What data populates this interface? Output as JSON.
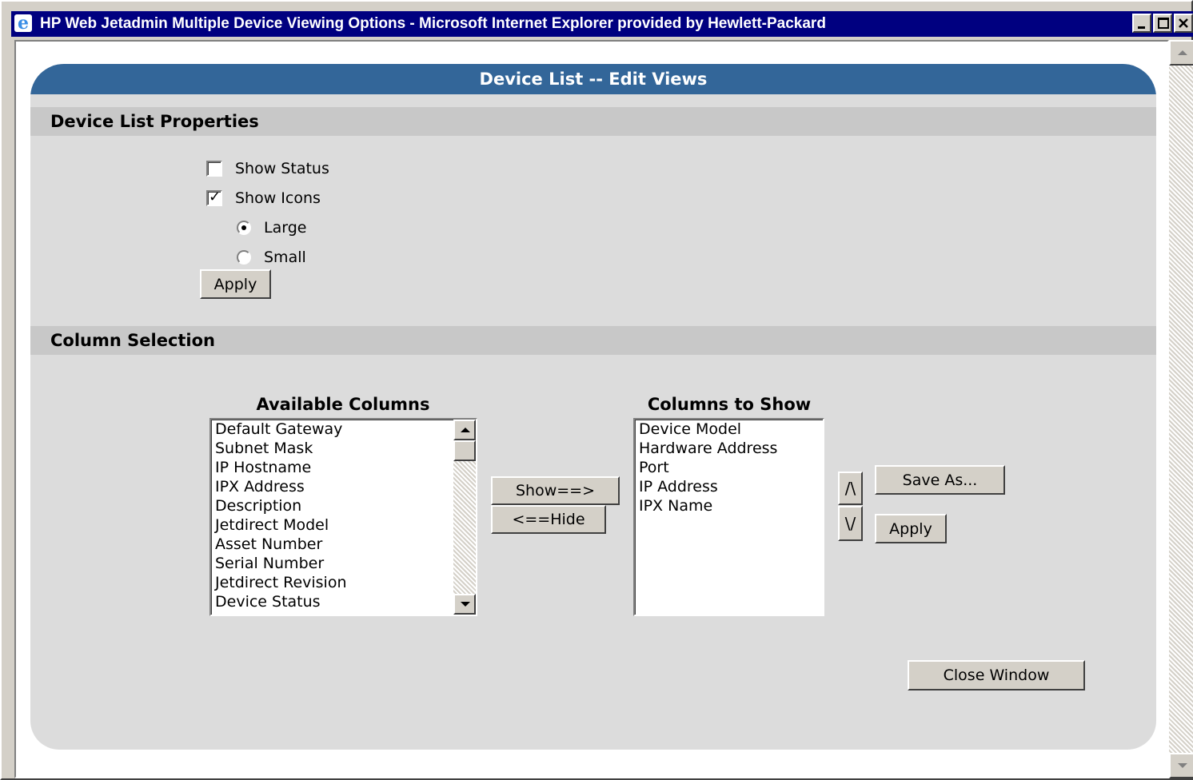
{
  "window": {
    "title": "HP Web Jetadmin Multiple Device Viewing Options - Microsoft Internet Explorer provided by Hewlett-Packard",
    "icon": "ie-icon"
  },
  "panel": {
    "header": "Device List -- Edit Views"
  },
  "properties": {
    "section_title": "Device List Properties",
    "show_status": {
      "label": "Show Status",
      "checked": false
    },
    "show_icons": {
      "label": "Show Icons",
      "checked": true
    },
    "icon_size": {
      "large_label": "Large",
      "small_label": "Small",
      "selected": "Large"
    },
    "apply_label": "Apply"
  },
  "columns": {
    "section_title": "Column Selection",
    "available_title": "Available Columns",
    "available": [
      "Default Gateway",
      "Subnet Mask",
      "IP Hostname",
      "IPX Address",
      "Description",
      "Jetdirect Model",
      "Asset Number",
      "Serial Number",
      "Jetdirect Revision",
      "Device Status"
    ],
    "show_label": "Show==>",
    "hide_label": "<==Hide",
    "to_show_title": "Columns to Show",
    "to_show": [
      "Device Model",
      "Hardware Address",
      "Port",
      "IP Address",
      "IPX Name"
    ],
    "move_up_label": "/\\",
    "move_down_label": "\\/",
    "save_as_label": "Save As...",
    "apply_label": "Apply"
  },
  "close_label": "Close Window"
}
